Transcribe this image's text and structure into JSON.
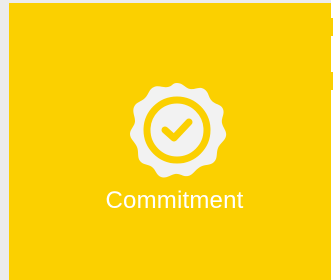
{
  "card": {
    "label": "Commitment",
    "icon": "certified-seal-check-icon",
    "colors": {
      "background": "#fbd000",
      "seal": "#f2f2f2",
      "accent": "#fbd000",
      "text": "#ffffff"
    }
  }
}
